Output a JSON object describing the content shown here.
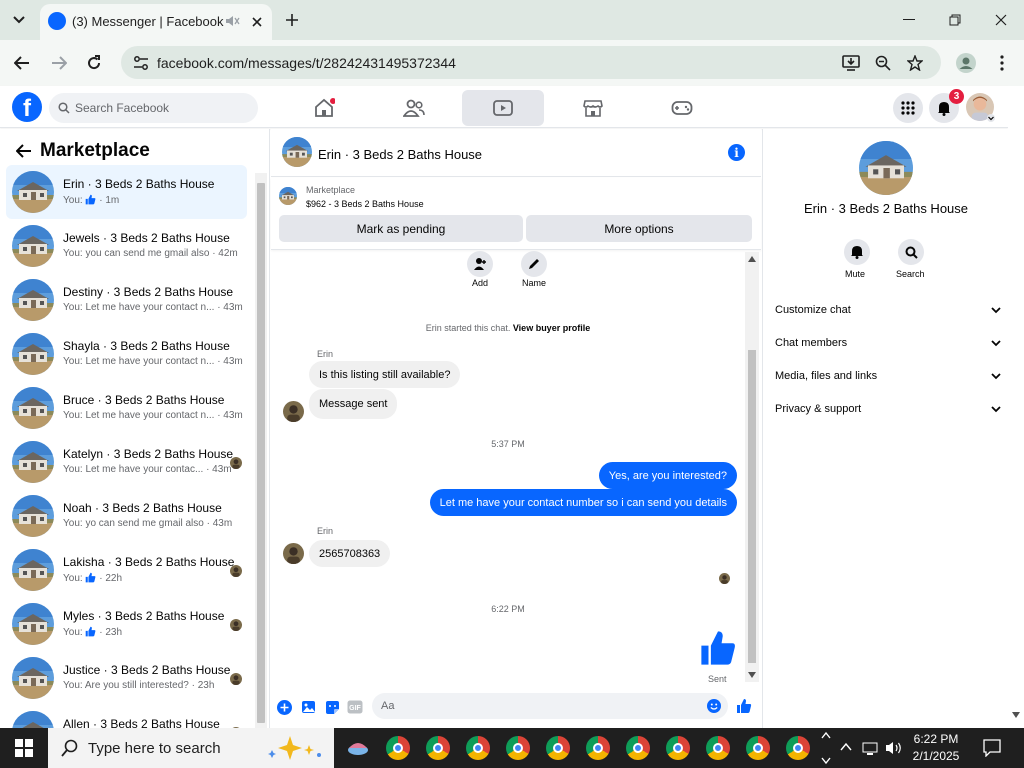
{
  "browser": {
    "tab_title": "(3) Messenger | Facebook",
    "url": "facebook.com/messages/t/28242431495372344"
  },
  "fb_header": {
    "search_placeholder": "Search Facebook",
    "notification_count": "3"
  },
  "left_panel": {
    "title": "Marketplace",
    "conversations": [
      {
        "name": "Erin · 3 Beds 2 Baths House",
        "preview_prefix": "You:",
        "preview": "",
        "time": "· 1m",
        "liked": true
      },
      {
        "name": "Jewels · 3 Beds 2 Baths House",
        "preview_prefix": "You:",
        "preview": "you can send me gmail also",
        "time": "· 42m",
        "liked": false
      },
      {
        "name": "Destiny · 3 Beds 2 Baths House",
        "preview_prefix": "You:",
        "preview": "Let me have your contact n...",
        "time": "· 43m",
        "liked": false
      },
      {
        "name": "Shayla · 3 Beds 2 Baths House",
        "preview_prefix": "You:",
        "preview": "Let me have your contact n...",
        "time": "· 43m",
        "liked": false
      },
      {
        "name": "Bruce · 3 Beds 2 Baths House",
        "preview_prefix": "You:",
        "preview": "Let me have your contact n...",
        "time": "· 43m",
        "liked": false
      },
      {
        "name": "Katelyn · 3 Beds 2 Baths House",
        "preview_prefix": "You:",
        "preview": "Let me have your contac...",
        "time": "· 43m",
        "liked": false
      },
      {
        "name": "Noah · 3 Beds 2 Baths House",
        "preview_prefix": "You:",
        "preview": "yo can send me gmail also",
        "time": "· 43m",
        "liked": false
      },
      {
        "name": "Lakisha · 3 Beds 2 Baths House",
        "preview_prefix": "You:",
        "preview": "",
        "time": "· 22h",
        "liked": true
      },
      {
        "name": "Myles · 3 Beds 2 Baths House",
        "preview_prefix": "You:",
        "preview": "",
        "time": "· 23h",
        "liked": true
      },
      {
        "name": "Justice · 3 Beds 2 Baths House",
        "preview_prefix": "You:",
        "preview": "Are you still interested?",
        "time": "· 23h",
        "liked": false
      },
      {
        "name": "Allen · 3 Beds 2 Baths House",
        "preview_prefix": "",
        "preview": "",
        "time": "",
        "liked": false
      }
    ]
  },
  "chat": {
    "title": "Erin · 3 Beds 2 Baths House",
    "listing_source": "Marketplace",
    "listing_price": "$962 - 3 Beds 2 Baths House",
    "mark_pending_label": "Mark as pending",
    "more_options_label": "More options",
    "add_label": "Add",
    "name_label": "Name",
    "started_text": "Erin started this chat.",
    "view_profile_label": "View buyer profile",
    "sender_name": "Erin",
    "msg_1": "Is this listing still available?",
    "msg_2": "Message sent",
    "time_1": "5:37 PM",
    "msg_3": "Yes, are you interested?",
    "msg_4": "Let me have your contact number so i can send you details",
    "msg_5": "2565708363",
    "time_2": "6:22 PM",
    "sent_label": "Sent",
    "composer_placeholder": "Aa"
  },
  "right_panel": {
    "title": "Erin · 3 Beds 2 Baths House",
    "mute_label": "Mute",
    "search_label": "Search",
    "sections": [
      "Customize chat",
      "Chat members",
      "Media, files and links",
      "Privacy & support"
    ]
  },
  "taskbar": {
    "search_placeholder": "Type here to search",
    "time": "6:22 PM",
    "date": "2/1/2025"
  },
  "colors": {
    "fb_blue": "#0866ff",
    "chrome_frame": "#dfe8e3",
    "badge_red": "#e41e3f"
  }
}
